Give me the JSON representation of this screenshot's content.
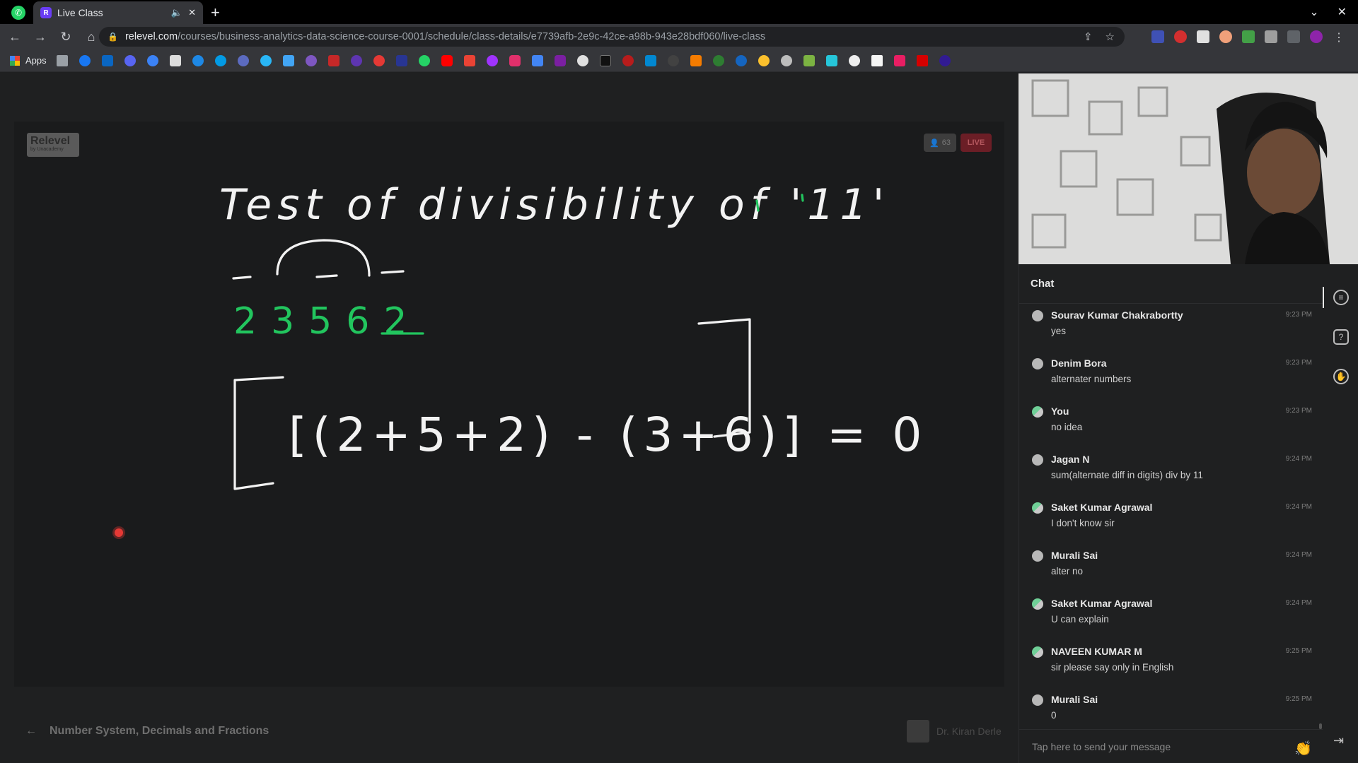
{
  "browser": {
    "tab_title": "Live Class",
    "tab_favicon": "R",
    "url_host": "relevel.com",
    "url_path": "/courses/business-analytics-data-science-course-0001/schedule/class-details/e7739afb-2e9c-42ce-a98b-943e28bdf060/live-class",
    "bookmarks_apps_label": "Apps"
  },
  "stage": {
    "logo_name": "Relevel",
    "logo_sub": "by Unacademy",
    "viewer_count": "63",
    "live_label": "LIVE",
    "board_title": "Test of divisibility of '11'",
    "number_digits": "23562",
    "equation": "[(2+5+2) - (3+6)] = 0",
    "bottom_title": "Number System, Decimals and Fractions",
    "educator_name": "Dr. Kiran Derle"
  },
  "chat": {
    "header": "Chat",
    "placeholder": "Tap here to send your message",
    "messages": [
      {
        "name": "Sourav Kumar Chakrabortty",
        "time": "9:23 PM",
        "text": "yes"
      },
      {
        "name": "Denim Bora",
        "time": "9:23 PM",
        "text": "alternater numbers"
      },
      {
        "name": "You",
        "time": "9:23 PM",
        "text": "no idea"
      },
      {
        "name": "Jagan N",
        "time": "9:24 PM",
        "text": "sum(alternate diff in digits) div by 11"
      },
      {
        "name": "Saket Kumar Agrawal",
        "time": "9:24 PM",
        "text": "I don't know sir"
      },
      {
        "name": "Murali Sai",
        "time": "9:24 PM",
        "text": "alter no"
      },
      {
        "name": "Saket Kumar Agrawal",
        "time": "9:24 PM",
        "text": "U can explain"
      },
      {
        "name": "NAVEEN KUMAR M",
        "time": "9:25 PM",
        "text": "sir please say only in English"
      },
      {
        "name": "Murali Sai",
        "time": "9:25 PM",
        "text": "0"
      }
    ]
  },
  "colors": {
    "chalk_white": "#f2f2f2",
    "chalk_green": "#22c55e",
    "live_red": "#6b1e26"
  },
  "icons": {
    "back": "←",
    "forward": "→",
    "reload": "↻",
    "home": "⌂",
    "lock": "🔒",
    "share": "⇪",
    "star": "☆",
    "close": "✕",
    "new_tab": "+",
    "mute": "🔈",
    "chevron_down": "⌄",
    "arrow_left": "←",
    "clap": "👏",
    "exit": "⇥",
    "question": "?",
    "hand": "✋",
    "chat": "≡"
  }
}
